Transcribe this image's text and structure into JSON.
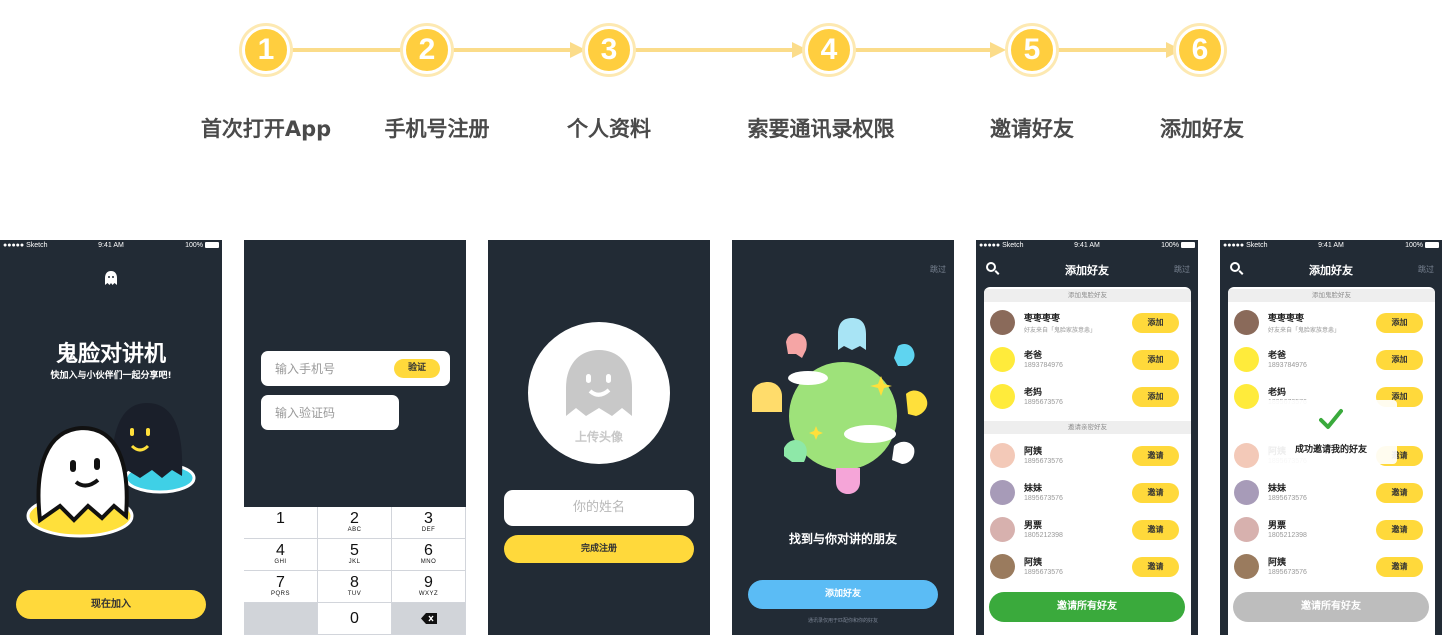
{
  "steps": [
    {
      "num": "1",
      "label": "首次打开App"
    },
    {
      "num": "2",
      "label": "手机号注册"
    },
    {
      "num": "3",
      "label": "个人资料"
    },
    {
      "num": "4",
      "label": "索要通讯录权限"
    },
    {
      "num": "5",
      "label": "邀请好友"
    },
    {
      "num": "6",
      "label": "添加好友"
    }
  ],
  "status_bar": {
    "carrier": "●●●●● Sketch",
    "time": "9:41 AM",
    "battery": "100%"
  },
  "screen1": {
    "title": "鬼脸对讲机",
    "subtitle": "快加入与小伙伴们一起分享吧!",
    "join_button": "现在加入"
  },
  "screen2": {
    "phone_placeholder": "输入手机号",
    "verify_button": "验证",
    "code_placeholder": "输入验证码",
    "keys": [
      {
        "num": "1",
        "letters": ""
      },
      {
        "num": "2",
        "letters": "ABC"
      },
      {
        "num": "3",
        "letters": "DEF"
      },
      {
        "num": "4",
        "letters": "GHI"
      },
      {
        "num": "5",
        "letters": "JKL"
      },
      {
        "num": "6",
        "letters": "MNO"
      },
      {
        "num": "7",
        "letters": "PQRS"
      },
      {
        "num": "8",
        "letters": "TUV"
      },
      {
        "num": "9",
        "letters": "WXYZ"
      },
      {
        "num": "0",
        "letters": ""
      }
    ]
  },
  "screen3": {
    "upload_avatar": "上传头像",
    "name_placeholder": "你的姓名",
    "finish_button": "完成注册"
  },
  "screen4": {
    "skip": "跳过",
    "headline": "找到与你对讲的朋友",
    "add_button": "添加好友",
    "footnote": "通讯录仅用于匹配你和你的好友"
  },
  "screen5": {
    "title": "添加好友",
    "skip": "跳过",
    "section1": "添加鬼脸好友",
    "section2": "邀请亲密好友",
    "rows": [
      {
        "name": "枣枣枣枣",
        "sub": "好友来自「鬼脸家族意恚」",
        "btn": "添加"
      },
      {
        "name": "老爸",
        "sub": "1893784976",
        "btn": "添加"
      },
      {
        "name": "老妈",
        "sub": "1895673576",
        "btn": "添加"
      },
      {
        "name": "阿姨",
        "sub": "1895673576",
        "btn": "邀请"
      },
      {
        "name": "妹妹",
        "sub": "1895673576",
        "btn": "邀请"
      },
      {
        "name": "男票",
        "sub": "1805212398",
        "btn": "邀请"
      },
      {
        "name": "阿姨",
        "sub": "1895673576",
        "btn": "邀请"
      }
    ],
    "invite_all": "邀请所有好友"
  },
  "screen6": {
    "title": "添加好友",
    "skip": "跳过",
    "section1": "添加鬼脸好友",
    "rows": [
      {
        "name": "枣枣枣枣",
        "sub": "好友来自「鬼脸家族意恚」",
        "btn": "添加"
      },
      {
        "name": "老爸",
        "sub": "1893784976",
        "btn": "添加"
      },
      {
        "name": "老妈",
        "sub": "1895673576",
        "btn": "添加"
      },
      {
        "name": "阿姨",
        "sub": "1895673576",
        "btn": "邀请"
      },
      {
        "name": "妹妹",
        "sub": "1895673576",
        "btn": "邀请"
      },
      {
        "name": "男票",
        "sub": "1805212398",
        "btn": "邀请"
      },
      {
        "name": "阿姨",
        "sub": "1895673576",
        "btn": "邀请"
      }
    ],
    "toast": "成功邀请我的好友",
    "invite_all": "邀请所有好友"
  },
  "colors": {
    "dark": "#222b35",
    "yellow": "#ffd93b",
    "green": "#3aaa3c",
    "blue": "#5bbcf5",
    "gray_btn": "#bdbdbd"
  }
}
